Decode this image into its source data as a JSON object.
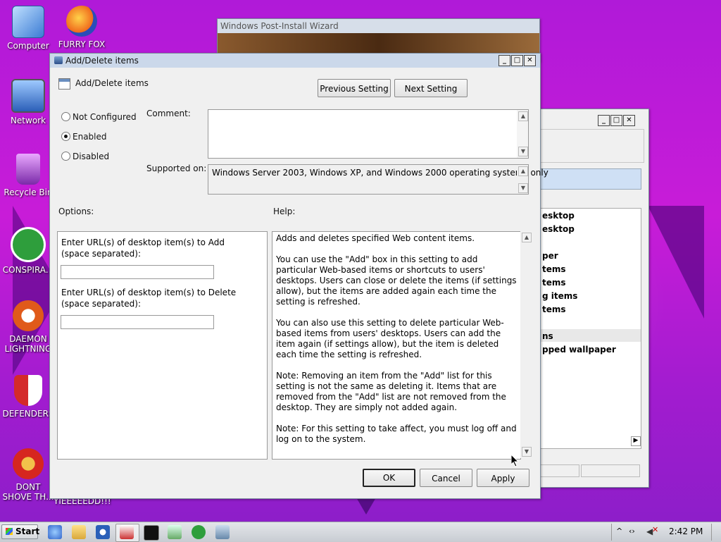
{
  "desktop": {
    "icons": [
      {
        "label": "Computer"
      },
      {
        "label": "FURRY FOX"
      },
      {
        "label": "Network"
      },
      {
        "label": "Recycle Bin"
      },
      {
        "label": "CONSPIRA..."
      },
      {
        "label": "DAEMON LIGHTNING"
      },
      {
        "label": "DEFENDERS"
      },
      {
        "label": "DONT SHOVE TH..."
      },
      {
        "label": "YIEEEEEDD!!!"
      }
    ]
  },
  "bg_window": {
    "title": "Windows Post-Install Wizard"
  },
  "back_window": {
    "list_items": [
      "esktop",
      "esktop",
      "per",
      "tems",
      "tems",
      "g items",
      "tems",
      "ns",
      "pped wallpaper"
    ]
  },
  "dialog": {
    "title": "Add/Delete items",
    "setting_name": "Add/Delete items",
    "previous_button": "Previous Setting",
    "next_button": "Next Setting",
    "options": {
      "not_configured": "Not Configured",
      "enabled": "Enabled",
      "disabled": "Disabled",
      "selected": "Enabled"
    },
    "comment_label": "Comment:",
    "comment_value": "",
    "supported_label": "Supported on:",
    "supported_value": "Windows Server 2003, Windows XP, and Windows 2000 operating systems only",
    "options_header": "Options:",
    "help_header": "Help:",
    "add_label": "Enter URL(s) of desktop item(s) to Add (space separated):",
    "add_value": "",
    "delete_label": "Enter URL(s) of desktop item(s) to Delete (space separated):",
    "delete_value": "",
    "help_text": [
      "Adds and deletes specified Web content items.",
      "You can use the \"Add\" box in this setting to add particular Web-based items or shortcuts to users' desktops. Users can close or delete the items (if settings allow), but the items are added again each time the setting is refreshed.",
      "You can also use this setting to delete particular Web-based items from users' desktops. Users can add the item again (if settings allow), but the item is deleted each time the setting is refreshed.",
      "Note: Removing an item from the \"Add\" list for this setting is not the same as deleting it. Items that are removed from the \"Add\" list are not removed from the desktop. They are simply not added again.",
      "Note: For this setting to take affect, you must log off and log on to the system."
    ],
    "ok_button": "OK",
    "cancel_button": "Cancel",
    "apply_button": "Apply"
  },
  "taskbar": {
    "start_label": "Start",
    "clock": "2:42 PM"
  }
}
